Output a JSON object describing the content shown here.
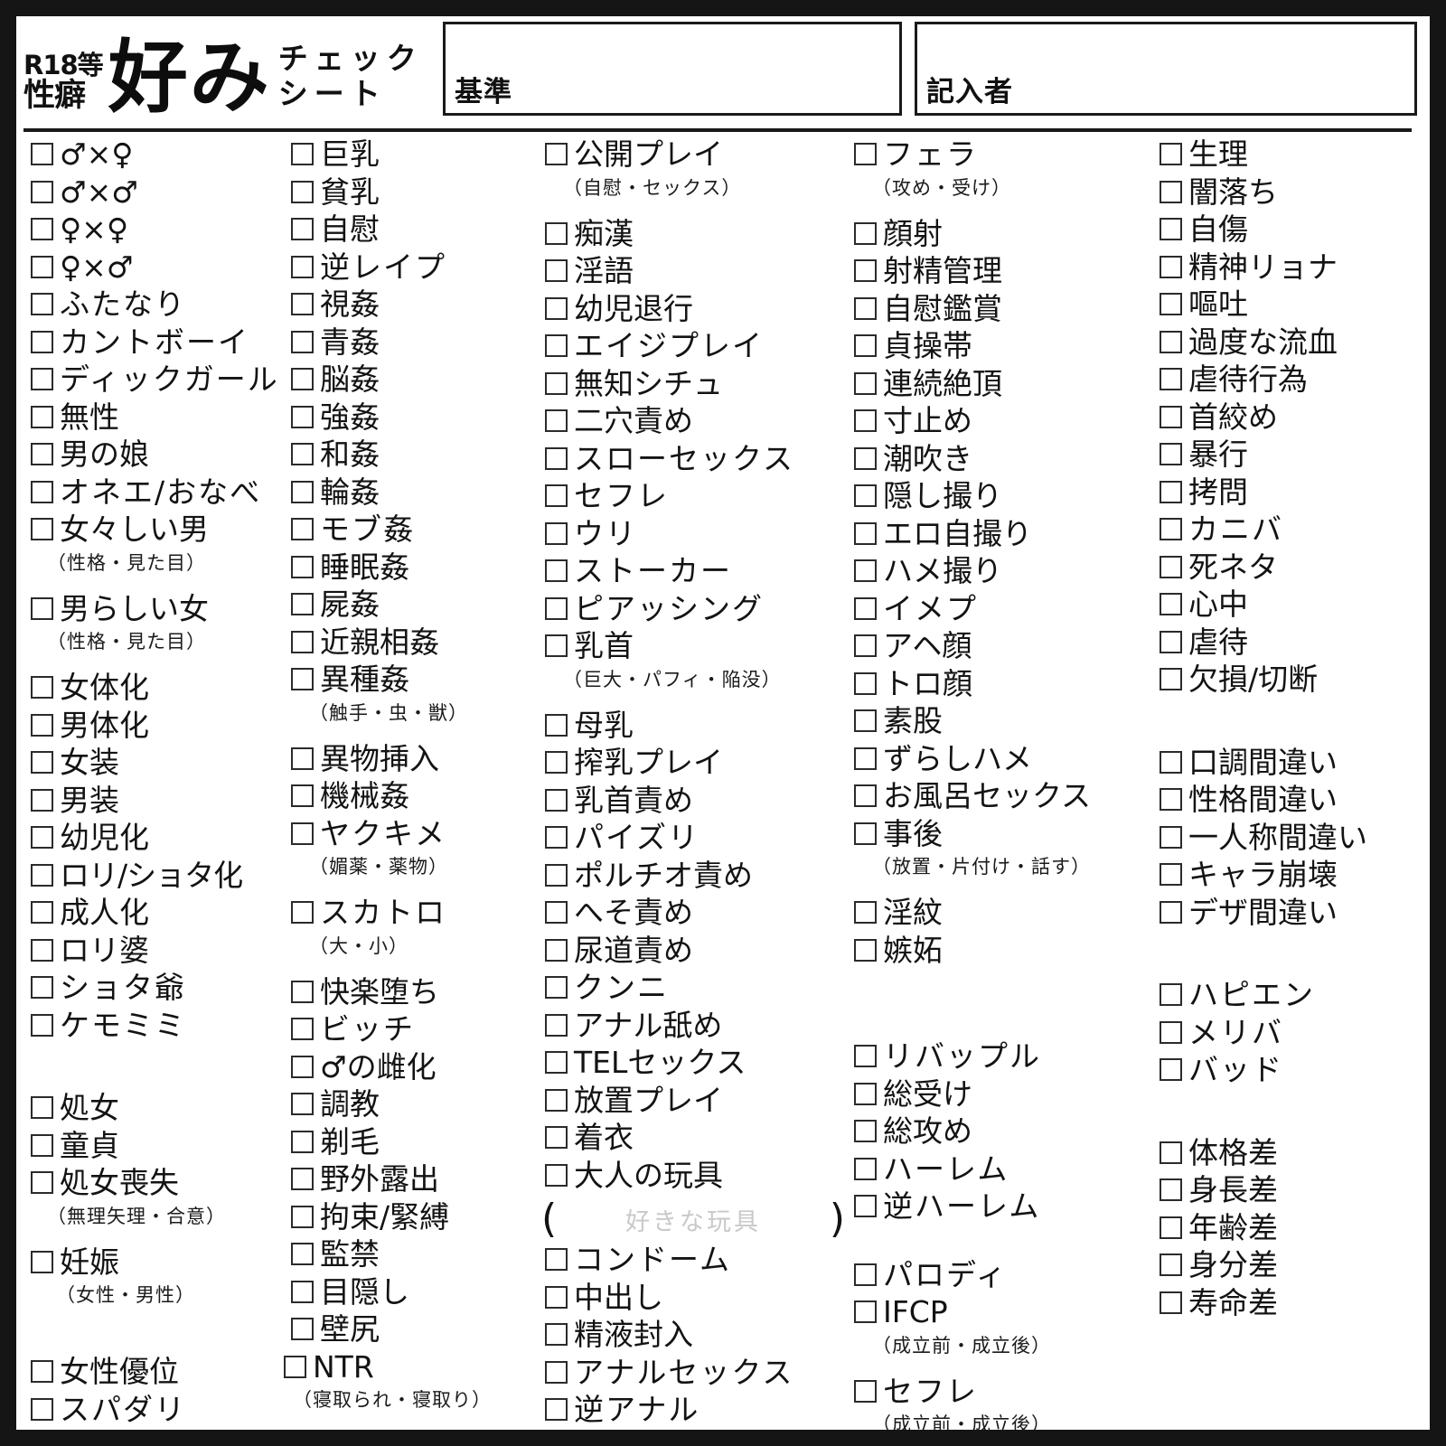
{
  "header": {
    "title_small_line1": "R18等",
    "title_small_line2": "性癖",
    "title_big": "好み",
    "title_kana_line1": "チェック",
    "title_kana_line2": "シート",
    "fields": [
      {
        "name": "kijun",
        "label": "基準",
        "value": ""
      },
      {
        "name": "kinyusha",
        "label": "記入者",
        "value": ""
      }
    ]
  },
  "columns": [
    {
      "id": "col1",
      "items": [
        {
          "label": "♂×♀"
        },
        {
          "label": "♂×♂"
        },
        {
          "label": "♀×♀"
        },
        {
          "label": "♀×♂"
        },
        {
          "label": "ふたなり"
        },
        {
          "label": "カントボーイ"
        },
        {
          "label": "ディックガール"
        },
        {
          "label": "無性"
        },
        {
          "label": "男の娘"
        },
        {
          "label": "オネエ/おなべ"
        },
        {
          "label": "女々しい男",
          "sub": "（性格・見た目）"
        },
        {
          "label": "男らしい女",
          "sub": "（性格・見た目）"
        },
        {
          "label": "女体化"
        },
        {
          "label": "男体化"
        },
        {
          "label": "女装"
        },
        {
          "label": "男装"
        },
        {
          "label": "幼児化"
        },
        {
          "label": "ロリ/ショタ化"
        },
        {
          "label": "成人化"
        },
        {
          "label": "ロリ婆"
        },
        {
          "label": "ショタ爺"
        },
        {
          "label": "ケモミミ"
        },
        {
          "label": "処女"
        },
        {
          "label": "童貞"
        },
        {
          "label": "処女喪失",
          "sub": "（無理矢理・合意）"
        },
        {
          "label": "妊娠",
          "sub": "（女性・男性）"
        },
        {
          "label": "女性優位"
        },
        {
          "label": "スパダリ"
        }
      ]
    },
    {
      "id": "col2",
      "items": [
        {
          "label": "巨乳"
        },
        {
          "label": "貧乳"
        },
        {
          "label": "自慰"
        },
        {
          "label": "逆レイプ"
        },
        {
          "label": "視姦"
        },
        {
          "label": "青姦"
        },
        {
          "label": "脳姦"
        },
        {
          "label": "強姦"
        },
        {
          "label": "和姦"
        },
        {
          "label": "輪姦"
        },
        {
          "label": "モブ姦"
        },
        {
          "label": "睡眠姦"
        },
        {
          "label": "屍姦"
        },
        {
          "label": "近親相姦"
        },
        {
          "label": "異種姦",
          "sub": "（触手・虫・獣）"
        },
        {
          "label": "異物挿入"
        },
        {
          "label": "機械姦"
        },
        {
          "label": "ヤクキメ",
          "sub": "（媚薬・薬物）"
        },
        {
          "label": "スカトロ",
          "sub": "（大・小）"
        },
        {
          "label": "快楽堕ち"
        },
        {
          "label": "ビッチ"
        },
        {
          "label": "♂の雌化"
        },
        {
          "label": "調教"
        },
        {
          "label": "剃毛"
        },
        {
          "label": "野外露出"
        },
        {
          "label": "拘束/緊縛"
        },
        {
          "label": "監禁"
        },
        {
          "label": "目隠し"
        },
        {
          "label": "壁尻"
        },
        {
          "label": "NTR",
          "sub": "（寝取られ・寝取り）"
        }
      ]
    },
    {
      "id": "col3",
      "items": [
        {
          "label": "公開プレイ",
          "sub": "（自慰・セックス）"
        },
        {
          "label": "痴漢"
        },
        {
          "label": "淫語"
        },
        {
          "label": "幼児退行"
        },
        {
          "label": "エイジプレイ"
        },
        {
          "label": "無知シチュ"
        },
        {
          "label": "二穴責め"
        },
        {
          "label": "スローセックス"
        },
        {
          "label": "セフレ"
        },
        {
          "label": "ウリ"
        },
        {
          "label": "ストーカー"
        },
        {
          "label": "ピアッシング"
        },
        {
          "label": "乳首",
          "sub": "（巨大・パフィ・陥没）"
        },
        {
          "label": "母乳"
        },
        {
          "label": "搾乳プレイ"
        },
        {
          "label": "乳首責め"
        },
        {
          "label": "パイズリ"
        },
        {
          "label": "ポルチオ責め"
        },
        {
          "label": "へそ責め"
        },
        {
          "label": "尿道責め"
        },
        {
          "label": "クンニ"
        },
        {
          "label": "アナル舐め"
        },
        {
          "label": "TELセックス"
        },
        {
          "label": "放置プレイ"
        },
        {
          "label": "着衣"
        },
        {
          "label": "大人の玩具",
          "freewrite_placeholder": "好きな玩具"
        },
        {
          "label": "コンドーム"
        },
        {
          "label": "中出し"
        },
        {
          "label": "精液封入"
        },
        {
          "label": "アナルセックス"
        },
        {
          "label": "逆アナル"
        }
      ]
    },
    {
      "id": "col4",
      "items": [
        {
          "label": "フェラ",
          "sub": "（攻め・受け）"
        },
        {
          "label": "顔射"
        },
        {
          "label": "射精管理"
        },
        {
          "label": "自慰鑑賞"
        },
        {
          "label": "貞操帯"
        },
        {
          "label": "連続絶頂"
        },
        {
          "label": "寸止め"
        },
        {
          "label": "潮吹き"
        },
        {
          "label": "隠し撮り"
        },
        {
          "label": "エロ自撮り"
        },
        {
          "label": "ハメ撮り"
        },
        {
          "label": "イメプ"
        },
        {
          "label": "アヘ顔"
        },
        {
          "label": "トロ顔"
        },
        {
          "label": "素股"
        },
        {
          "label": "ずらしハメ"
        },
        {
          "label": "お風呂セックス"
        },
        {
          "label": "事後",
          "sub": "（放置・片付け・話す）"
        },
        {
          "label": "淫紋"
        },
        {
          "label": "嫉妬"
        },
        {
          "label": "リバップル"
        },
        {
          "label": "総受け"
        },
        {
          "label": "総攻め"
        },
        {
          "label": "ハーレム"
        },
        {
          "label": "逆ハーレム"
        },
        {
          "label": "パロディ"
        },
        {
          "label": "IFCP",
          "sub": "（成立前・成立後）"
        },
        {
          "label": "セフレ",
          "sub": "（成立前・成立後）"
        }
      ]
    },
    {
      "id": "col5",
      "items": [
        {
          "label": "生理"
        },
        {
          "label": "闇落ち"
        },
        {
          "label": "自傷"
        },
        {
          "label": "精神リョナ"
        },
        {
          "label": "嘔吐"
        },
        {
          "label": "過度な流血"
        },
        {
          "label": "虐待行為"
        },
        {
          "label": "首絞め"
        },
        {
          "label": "暴行"
        },
        {
          "label": "拷問"
        },
        {
          "label": "カニバ"
        },
        {
          "label": "死ネタ"
        },
        {
          "label": "心中"
        },
        {
          "label": "虐待"
        },
        {
          "label": "欠損/切断"
        },
        {
          "label": "口調間違い"
        },
        {
          "label": "性格間違い"
        },
        {
          "label": "一人称間違い"
        },
        {
          "label": "キャラ崩壊"
        },
        {
          "label": "デザ間違い"
        },
        {
          "label": "ハピエン"
        },
        {
          "label": "メリバ"
        },
        {
          "label": "バッド"
        },
        {
          "label": "体格差"
        },
        {
          "label": "身長差"
        },
        {
          "label": "年齢差"
        },
        {
          "label": "身分差"
        },
        {
          "label": "寿命差"
        }
      ]
    }
  ],
  "colors": {
    "page_background": "#151515",
    "sheet_background": "#ffffff",
    "ink": "#131313",
    "placeholder": "#c9c9c9"
  }
}
